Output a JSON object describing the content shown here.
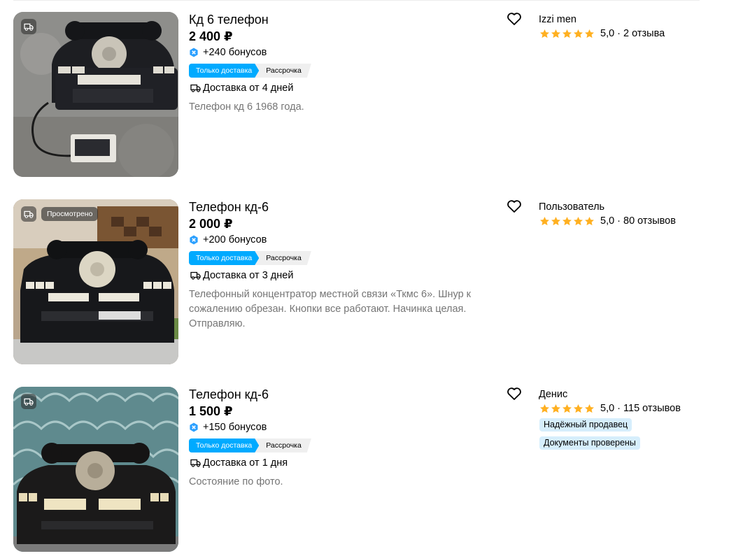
{
  "items": [
    {
      "title": "Кд 6 телефон",
      "price": "2 400 ₽",
      "bonus": "+240 бонусов",
      "tag_delivery": "Только доставка",
      "tag_installment": "Рассрочка",
      "delivery": "Доставка от 4 дней",
      "description": "Телефон кд 6 1968 года.",
      "viewed": "",
      "seller": {
        "name": "Izzi men",
        "score": "5,0",
        "reviews": "2 отзыва",
        "badges": []
      }
    },
    {
      "title": "Телефон кд-6",
      "price": "2 000 ₽",
      "bonus": "+200 бонусов",
      "tag_delivery": "Только доставка",
      "tag_installment": "Рассрочка",
      "delivery": "Доставка от 3 дней",
      "description": "Телефонный концентратор местной связи «Ткмс 6». Шнур к сожалению обрезан. Кнопки все работают. Начинка целая. Отправляю.",
      "viewed": "Просмотрено",
      "seller": {
        "name": "Пользователь",
        "score": "5,0",
        "reviews": "80 отзывов",
        "badges": []
      }
    },
    {
      "title": "Телефон кд-6",
      "price": "1 500 ₽",
      "bonus": "+150 бонусов",
      "tag_delivery": "Только доставка",
      "tag_installment": "Рассрочка",
      "delivery": "Доставка от 1 дня",
      "description": "Состояние по фото.",
      "viewed": "",
      "seller": {
        "name": "Денис",
        "score": "5,0",
        "reviews": "115 отзывов",
        "badges": [
          "Надёжный продавец",
          "Документы проверены"
        ]
      }
    }
  ],
  "separator": "·",
  "colors": {
    "accent": "#00aaff",
    "star": "#ffb021",
    "muted": "#757575",
    "badge_bg": "#d6eefc",
    "tag_bg": "#efefef"
  },
  "icons": [
    "delivery-truck-icon",
    "bonus-icon",
    "heart-icon",
    "star-icon"
  ]
}
